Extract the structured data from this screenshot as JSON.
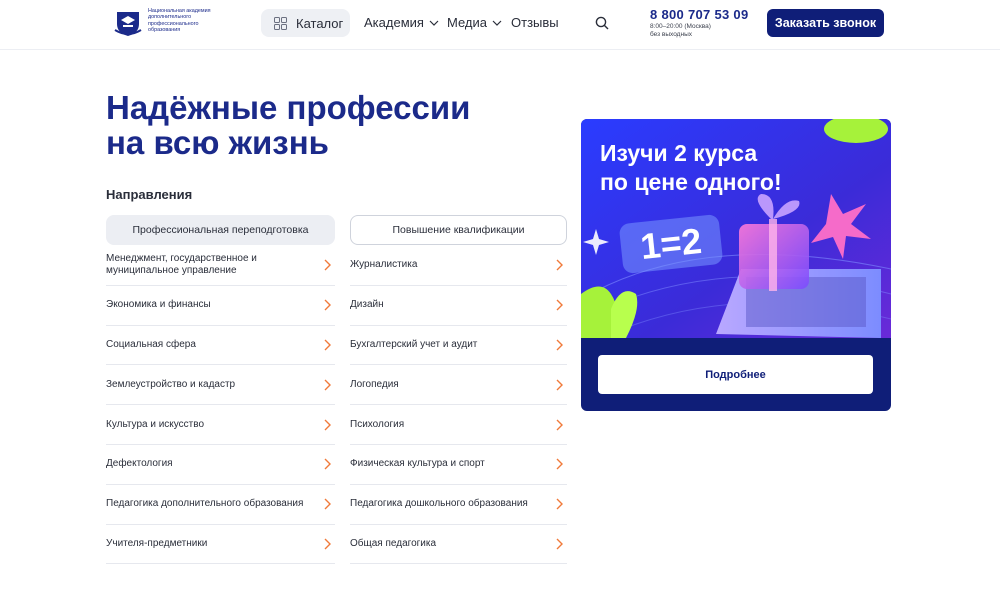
{
  "header": {
    "logo_text": "Национальная академия\nдополнительного\nпрофессионального\nобразования",
    "catalog_label": "Каталог",
    "nav": [
      {
        "label": "Академия"
      },
      {
        "label": "Медиа"
      },
      {
        "label": "Отзывы"
      }
    ],
    "phone": "8 800 707 53 09",
    "hours": "8:00–20:00 (Москва)\nбез выходных",
    "call_button": "Заказать звонок"
  },
  "hero": {
    "title": "Надёжные профессии\nна всю жизнь",
    "directions_label": "Направления"
  },
  "tabs": {
    "active": "Профессиональная переподготовка",
    "inactive": "Повышение квалификации"
  },
  "left_list": [
    "Менеджмент, государственное и муниципальное управление",
    "Экономика и финансы",
    "Социальная сфера",
    "Землеустройство и кадастр",
    "Культура и искусство",
    "Дефектология",
    "Педагогика дополнительного образования",
    "Учителя-предметники"
  ],
  "right_list": [
    "Журналистика",
    "Дизайн",
    "Бухгалтерский учет и аудит",
    "Логопедия",
    "Психология",
    "Физическая культура и спорт",
    "Педагогика дошкольного образования",
    "Общая педагогика"
  ],
  "promo": {
    "title": "Изучи 2 курса\nпо цене одного!",
    "badge": "1=2",
    "button": "Подробнее"
  },
  "colors": {
    "brand": "#1b2a8a",
    "button_dark": "#0f1e78",
    "chevron": "#f07a3a"
  }
}
